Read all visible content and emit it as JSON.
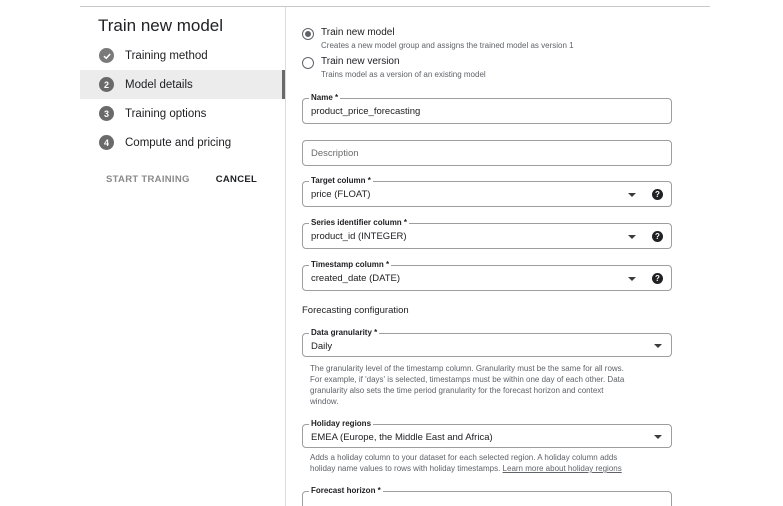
{
  "left": {
    "title": "Train new model",
    "steps": [
      {
        "label": "Training method",
        "icon": "check-icon",
        "status": "done"
      },
      {
        "label": "Model details",
        "number": "2",
        "status": "active"
      },
      {
        "label": "Training options",
        "number": "3",
        "status": "pending"
      },
      {
        "label": "Compute and pricing",
        "number": "4",
        "status": "pending"
      }
    ],
    "start_training_label": "START TRAINING",
    "cancel_label": "CANCEL"
  },
  "model_choice": {
    "options": [
      {
        "label": "Train new model",
        "description": "Creates a new model group and assigns the trained model as version 1",
        "selected": true
      },
      {
        "label": "Train new version",
        "description": "Trains model as a version of an existing model",
        "selected": false
      }
    ]
  },
  "fields": {
    "name": {
      "label": "Name *",
      "value": "product_price_forecasting"
    },
    "description": {
      "placeholder": "Description"
    },
    "target_column": {
      "label": "Target column *",
      "value": "price (FLOAT)"
    },
    "series_identifier": {
      "label": "Series identifier column *",
      "value": "product_id (INTEGER)"
    },
    "timestamp_column": {
      "label": "Timestamp column *",
      "value": "created_date (DATE)"
    }
  },
  "help_glyph": "?",
  "forecasting": {
    "section_title": "Forecasting configuration",
    "data_granularity": {
      "label": "Data granularity *",
      "value": "Daily",
      "hint_lines": [
        "The granularity level of the timestamp column. Granularity must be the same for all rows.",
        "For example, if 'days' is selected, timestamps must be within one day of each other. Data",
        "granularity also sets the time period granularity for the forecast horizon and context",
        "window."
      ]
    },
    "holiday_regions": {
      "label": "Holiday regions",
      "value": "EMEA (Europe, the Middle East and Africa)",
      "hint_line1": "Adds a holiday column to your dataset for each selected region. A holiday column adds",
      "hint_line2_text": "holiday name values to rows with holiday timestamps.",
      "hint_link": "Learn more about holiday regions"
    },
    "forecast_horizon": {
      "label": "Forecast horizon *"
    }
  },
  "colors": {
    "active_step_bg": "#ececec",
    "step_icon": "#6a6a6a",
    "field_border": "#9e9e9e",
    "disabled_text": "#8a8a8a"
  }
}
